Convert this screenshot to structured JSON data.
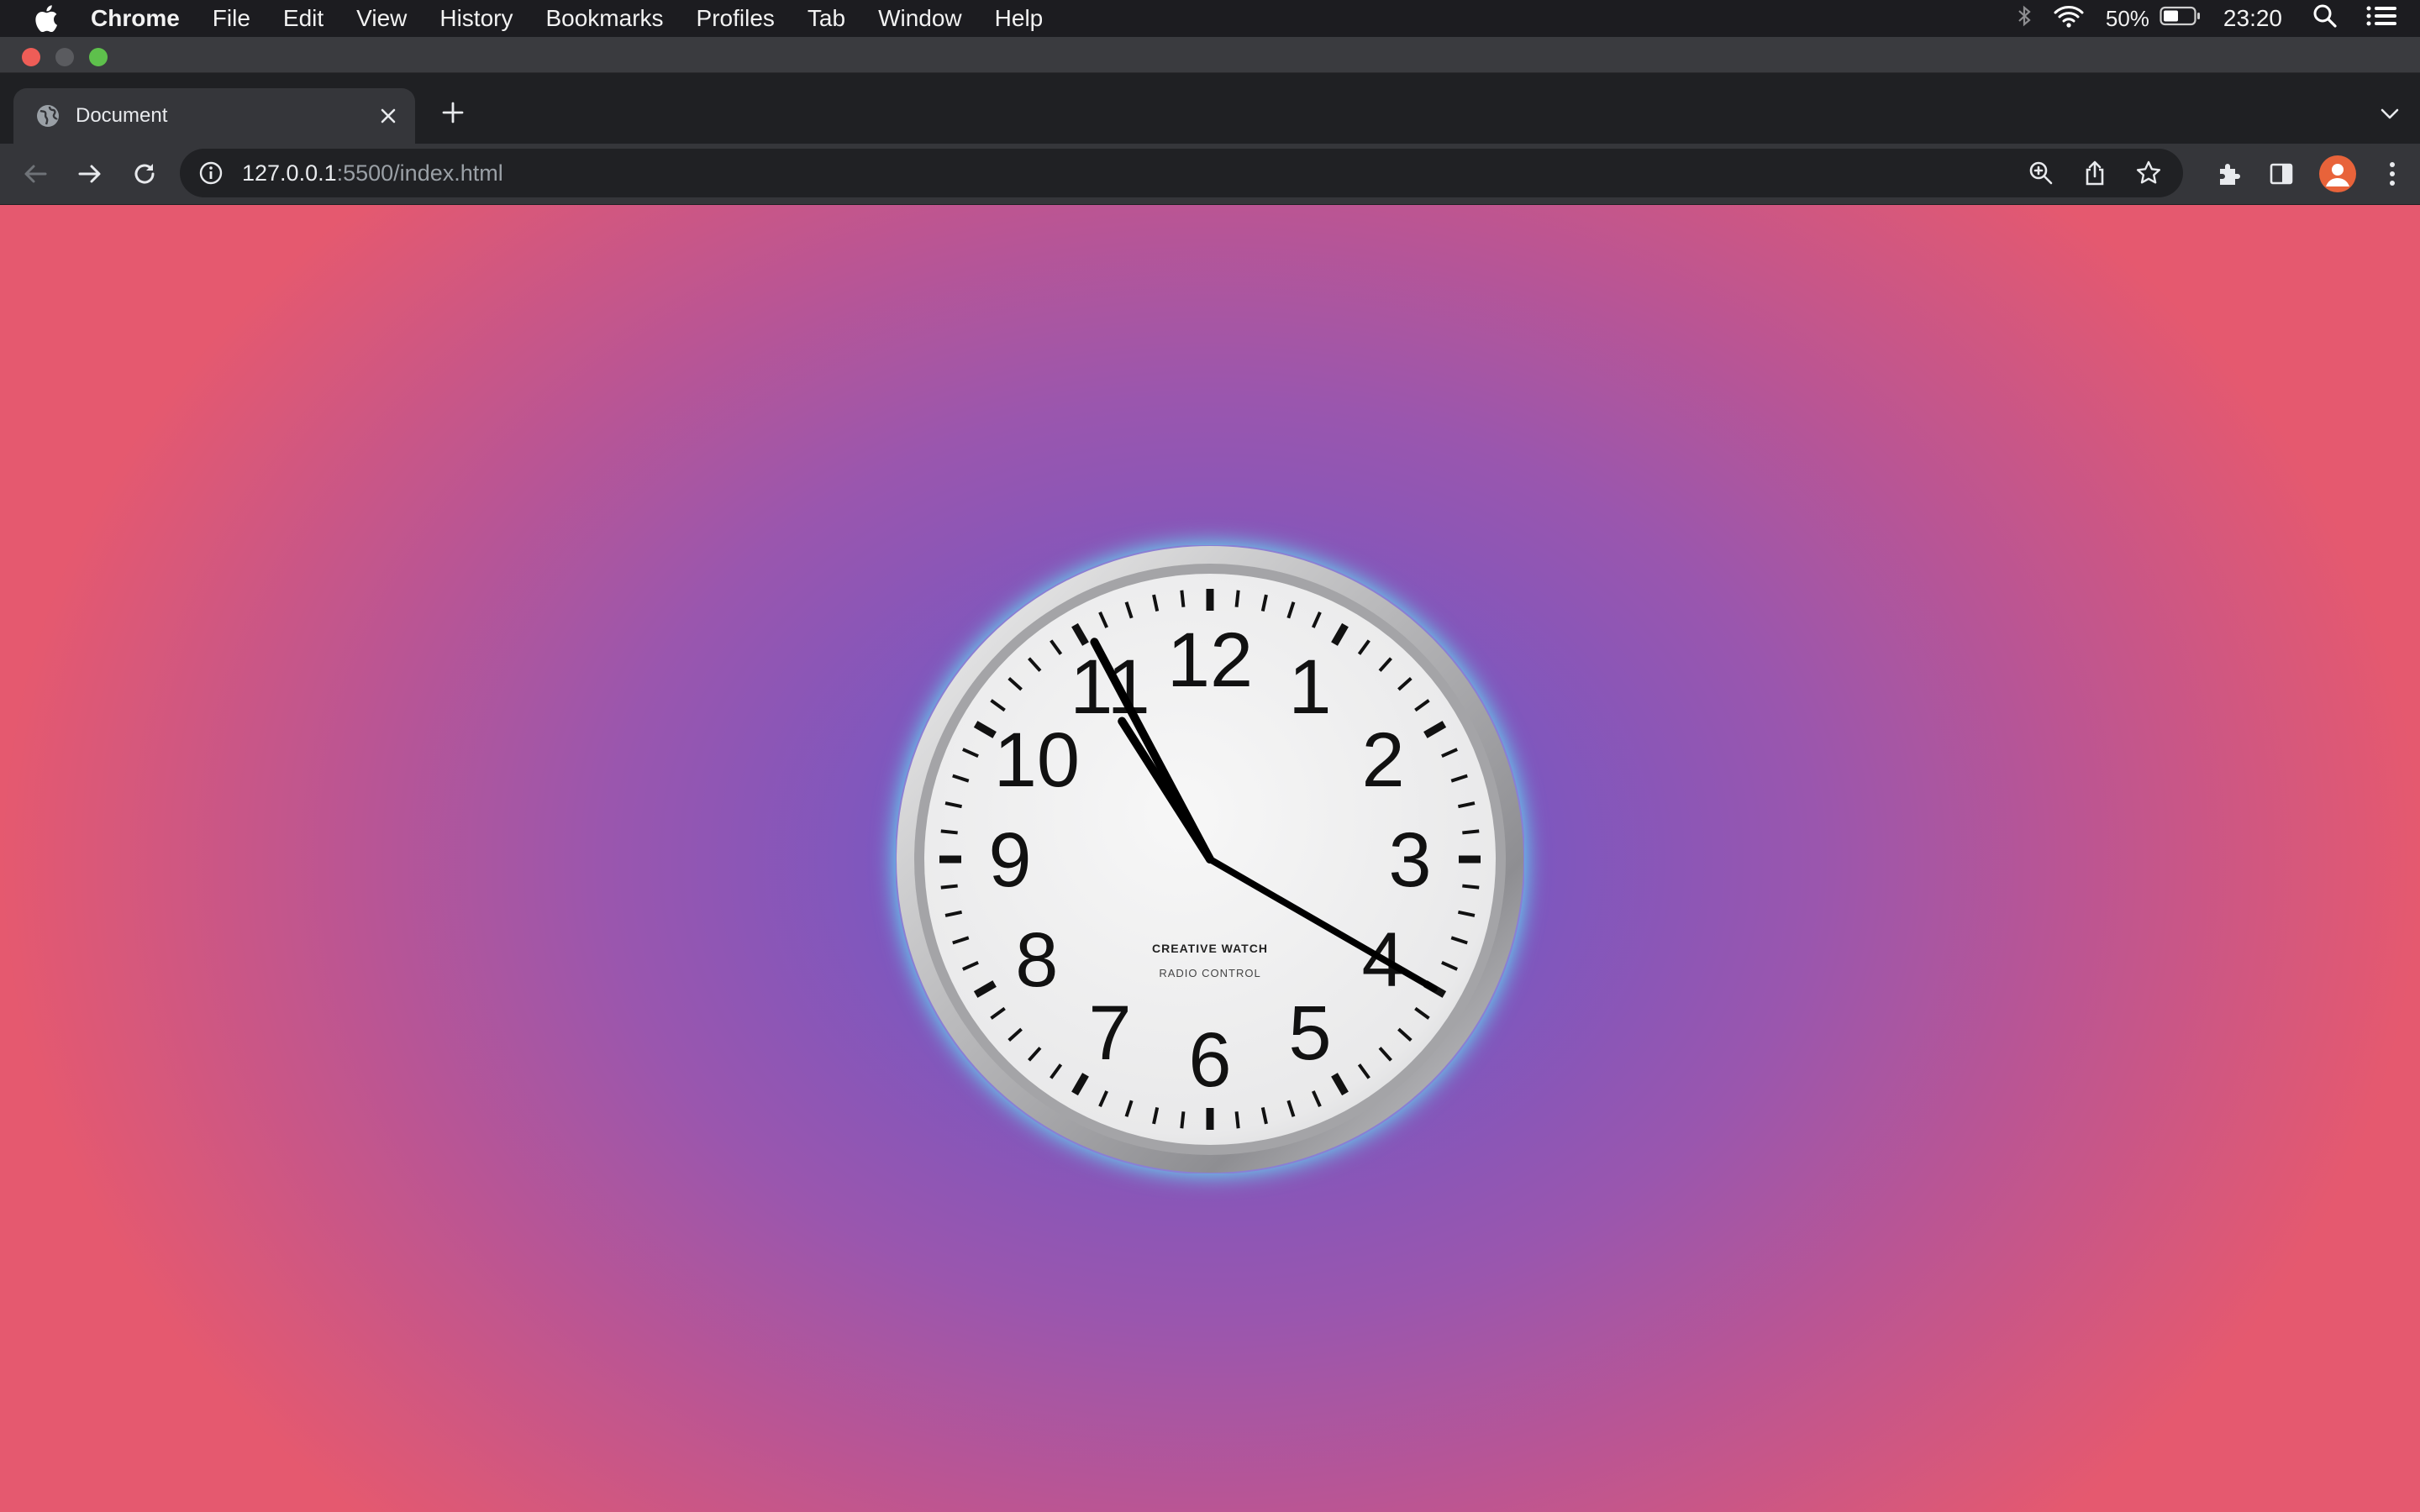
{
  "menubar": {
    "items": [
      "Chrome",
      "File",
      "Edit",
      "View",
      "History",
      "Bookmarks",
      "Profiles",
      "Tab",
      "Window",
      "Help"
    ],
    "battery": "50%",
    "time": "23:20"
  },
  "tab": {
    "title": "Document"
  },
  "address": {
    "host": "127.0.0.1",
    "rest": ":5500/index.html"
  },
  "clock": {
    "numerals": [
      "12",
      "1",
      "2",
      "3",
      "4",
      "5",
      "6",
      "7",
      "8",
      "9",
      "10",
      "11"
    ],
    "brand": "CREATIVE WATCH",
    "sub": "RADIO CONTROL",
    "time_shown": {
      "hour": 10,
      "minute": 55,
      "second": 20
    },
    "glow_color": "#5ff3ff"
  },
  "colors": {
    "bg_center": "#6a57d2",
    "bg_edge": "#e5596f"
  }
}
